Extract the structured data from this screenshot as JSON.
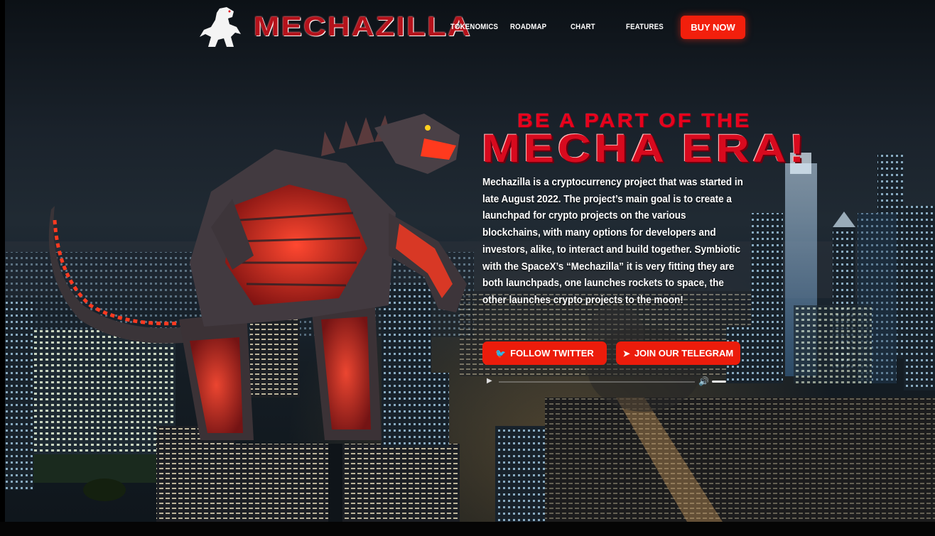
{
  "brand": {
    "name": "MECHAZILLA",
    "logo_icon": "mechazilla-monster-icon"
  },
  "nav": {
    "tokenomics": "TOKENOMICS",
    "roadmap": "ROADMAP",
    "chart": "CHART",
    "features": "FEATURES",
    "buy_now": "BUY NOW"
  },
  "hero": {
    "tagline": "BE A PART OF THE",
    "headline": "MECHA ERA!",
    "description": "Mechazilla is a cryptocurrency project that was started in late August 2022. The project’s main goal is to create a launchpad for crypto projects on the various blockchains, with many options for developers and investors, alike, to interact and build together. Symbiotic with the SpaceX’s “Mechazilla” it is very fitting they are both launchpads, one launches rockets to space, the other launches crypto projects to the moon!",
    "follow_twitter": "FOLLOW TWITTER",
    "join_telegram": "JOIN OUR TELEGRAM",
    "twitter_icon": "twitter-bird-icon",
    "telegram_icon": "telegram-plane-icon"
  },
  "audio_player": {
    "play_icon": "play-icon",
    "volume_icon": "volume-icon",
    "progress": 0
  },
  "colors": {
    "accent": "#f21f0c",
    "headline_red": "#d80a1e",
    "background": "#151d24"
  }
}
